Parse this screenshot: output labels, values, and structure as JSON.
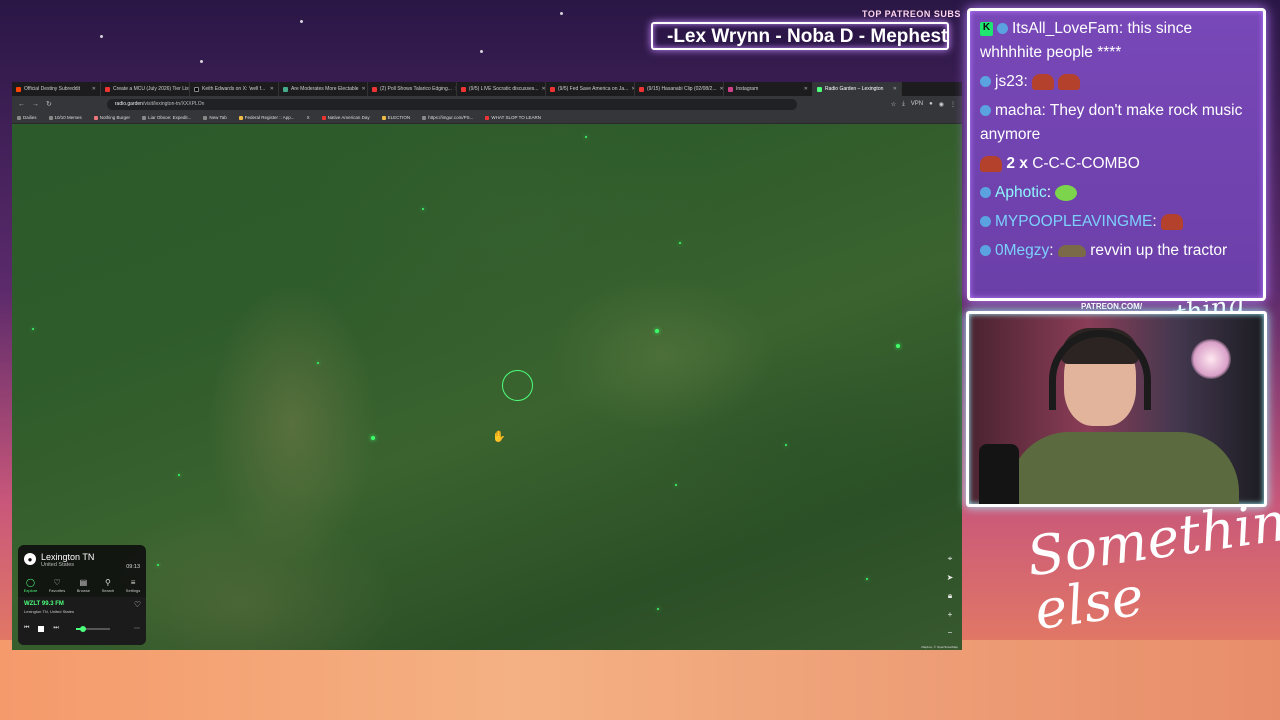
{
  "overlay": {
    "top_subs_label": "TOP PATREON SUBS",
    "ticker_text": "-Lex Wrynn -  Noba D - Mephest",
    "patreon_url": "PATREON.COM/",
    "signature": "Anything else?",
    "brand_script": "Something else"
  },
  "browser": {
    "tabs": [
      {
        "label": "Official Destiny Subreddit"
      },
      {
        "label": "Create a MCU (July 2026) Tier List"
      },
      {
        "label": "Keith Edwards on X: 'well f..."
      },
      {
        "label": "Are Moderates More Electable"
      },
      {
        "label": "(2) Poll Shows Talarico Edging..."
      },
      {
        "label": "(9/5) LIVE Socratic discusses..."
      },
      {
        "label": "(9/5) Fed Save America on Ja..."
      },
      {
        "label": "(9/15) Hasanabi Clip (02/08/2..."
      },
      {
        "label": "Instagram"
      },
      {
        "label": "Radio Garden – Lexington"
      }
    ],
    "url_host": "radio.garden",
    "url_path": "/visit/lexington-tn/XXXPLOn",
    "vpn_label": "VPN",
    "bookmarks": [
      "Dailies",
      "10/10 Memes",
      "Nothing Burger",
      "Liar Obsoe: Expedit...",
      "New Tab",
      "Federal Register :: App...",
      "X",
      "Native American Day",
      "ELECTION",
      "https://imgur.com/PS...",
      "WHAT SLOP TO LEARN"
    ]
  },
  "radio_garden": {
    "city": "Lexington TN",
    "country": "United States",
    "time": "09:13",
    "nav": [
      {
        "label": "Explore",
        "icon": "explore-icon"
      },
      {
        "label": "Favorites",
        "icon": "heart-icon"
      },
      {
        "label": "Browse",
        "icon": "browse-icon"
      },
      {
        "label": "Search",
        "icon": "search-icon"
      },
      {
        "label": "Settings",
        "icon": "menu-icon"
      }
    ],
    "station": "WZLT 99.3 FM",
    "station_location": "Lexington TN, United States",
    "volume": 0.2,
    "attribution": "Mapbox, © OpenStreetMap"
  },
  "chat": [
    {
      "user": "ItsAll_LoveFam",
      "text": "this since whhhhite people ****"
    },
    {
      "user": "js23",
      "text": ""
    },
    {
      "user": "macha",
      "text": "They don't make rock music anymore"
    },
    {
      "combo_count": "2 x",
      "combo_text": "C-C-C-COMBO"
    },
    {
      "user": "Aphotic",
      "text": ""
    },
    {
      "user": "MYPOOPLEAVINGME",
      "text": ""
    },
    {
      "user": "0Megzy",
      "text": "revvin up the tractor"
    }
  ],
  "colors": {
    "accent_green": "#4dff7c",
    "chat_bg": "#7848b8"
  }
}
